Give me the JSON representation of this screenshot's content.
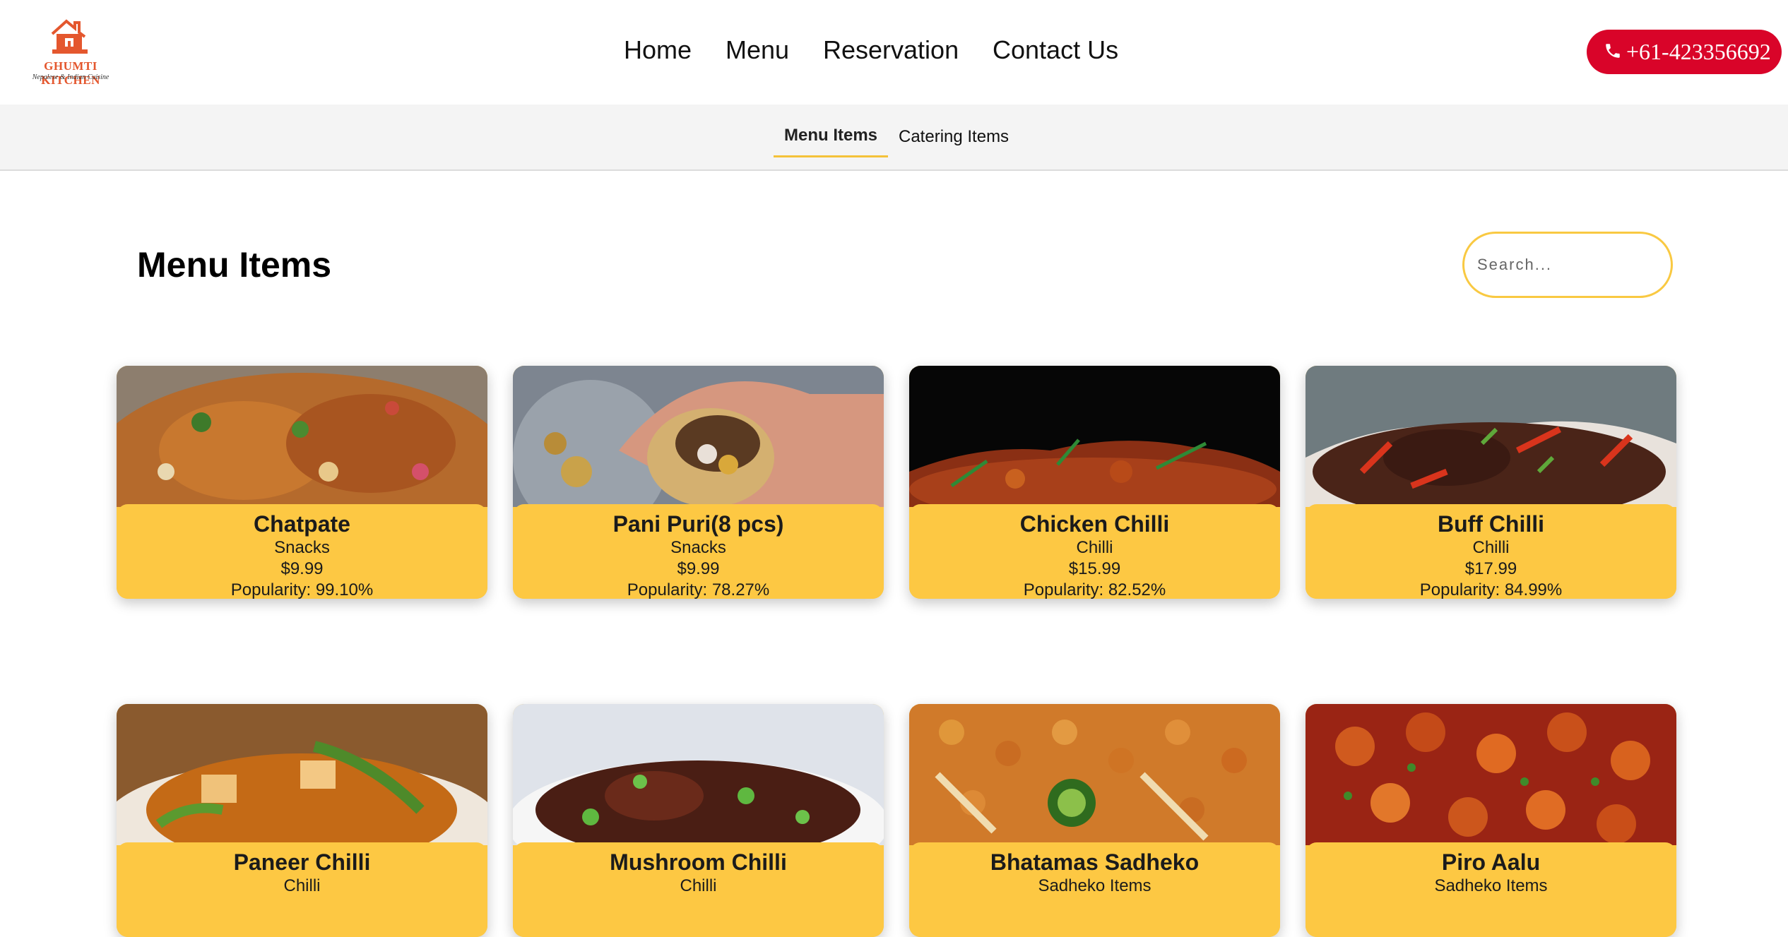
{
  "brand": {
    "name": "GHUMTI KITCHEN",
    "tagline": "Nepalese & Indian Cuisine",
    "accent": "#e4572e"
  },
  "nav": [
    {
      "label": "Home"
    },
    {
      "label": "Menu"
    },
    {
      "label": "Reservation"
    },
    {
      "label": "Contact Us"
    }
  ],
  "phone": {
    "label": "+61-423356692",
    "icon": "phone-icon",
    "color": "#d90429"
  },
  "tabs": [
    {
      "label": "Menu Items",
      "active": true
    },
    {
      "label": "Catering Items",
      "active": false
    }
  ],
  "main": {
    "title": "Menu Items",
    "search": {
      "placeholder": "Search...",
      "value": ""
    }
  },
  "items": [
    {
      "name": "Chatpate",
      "category": "Snacks",
      "price": "$9.99",
      "popularity": "Popularity: 99.10%"
    },
    {
      "name": "Pani Puri(8 pcs)",
      "category": "Snacks",
      "price": "$9.99",
      "popularity": "Popularity: 78.27%"
    },
    {
      "name": "Chicken Chilli",
      "category": "Chilli",
      "price": "$15.99",
      "popularity": "Popularity: 82.52%"
    },
    {
      "name": "Buff Chilli",
      "category": "Chilli",
      "price": "$17.99",
      "popularity": "Popularity: 84.99%"
    },
    {
      "name": "Paneer Chilli",
      "category": "Chilli",
      "price": "",
      "popularity": ""
    },
    {
      "name": "Mushroom Chilli",
      "category": "Chilli",
      "price": "",
      "popularity": ""
    },
    {
      "name": "Bhatamas Sadheko",
      "category": "Sadheko Items",
      "price": "",
      "popularity": ""
    },
    {
      "name": "Piro Aalu",
      "category": "Sadheko Items",
      "price": "",
      "popularity": ""
    }
  ],
  "colors": {
    "card": "#fdc843",
    "tabUnderline": "#f4c23a",
    "searchBorder": "#f9c942"
  }
}
